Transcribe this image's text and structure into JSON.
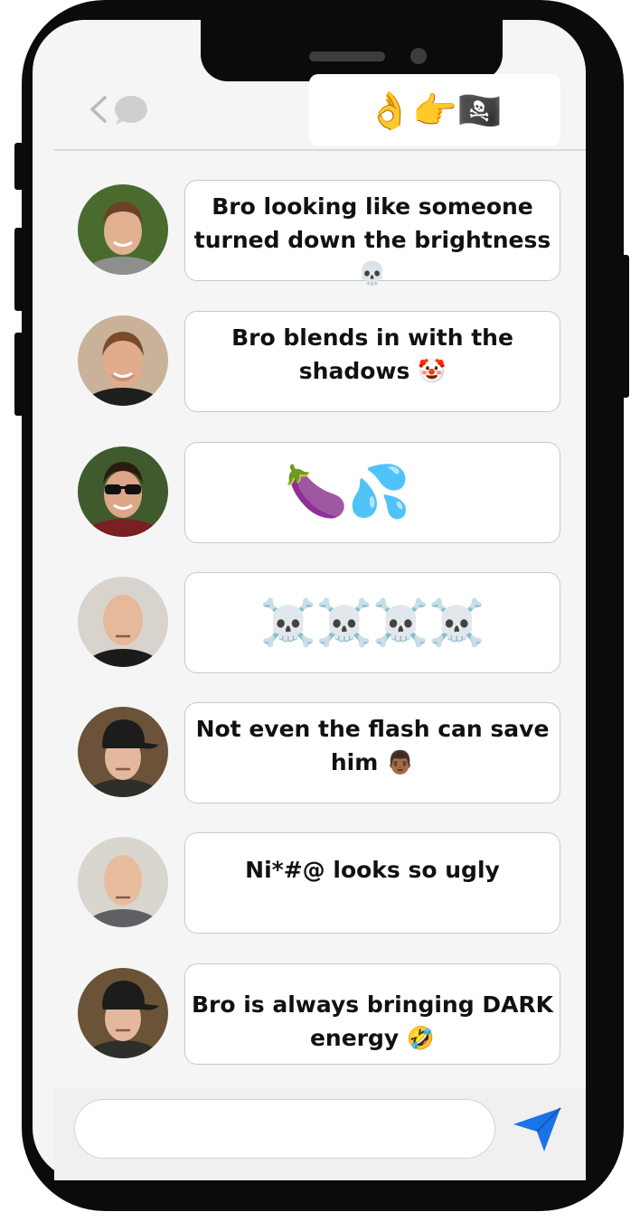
{
  "header": {
    "back_icon": "chevron-left-icon",
    "chat_icon": "chat-bubble-icon",
    "title": "👌👉🏴‍☠️"
  },
  "messages": [
    {
      "text": "Bro looking like someone turned down the brightness💀",
      "avatar": "young man smiling outdoors"
    },
    {
      "text": "Bro blends in with the shadows 🤡",
      "avatar": "man with stubble smiling"
    },
    {
      "text": "🍆💦",
      "avatar": "man wearing sunglasses"
    },
    {
      "text": "☠️☠️☠️☠️",
      "avatar": "bald man in black jacket"
    },
    {
      "text": "Not even the flash can save him 👨🏾",
      "avatar": "man in black cap"
    },
    {
      "text": "Ni*#@ looks so ugly",
      "avatar": "bald man in gray shirt"
    },
    {
      "text": "Bro is always bringing DARK energy 🤣",
      "avatar": "man in black cap"
    }
  ],
  "composer": {
    "placeholder": "",
    "send_icon": "send-arrow-icon"
  },
  "colors": {
    "send_accent": "#1a73e8",
    "bubble_border": "#c9c9c9",
    "screen_bg": "#f5f5f5"
  }
}
